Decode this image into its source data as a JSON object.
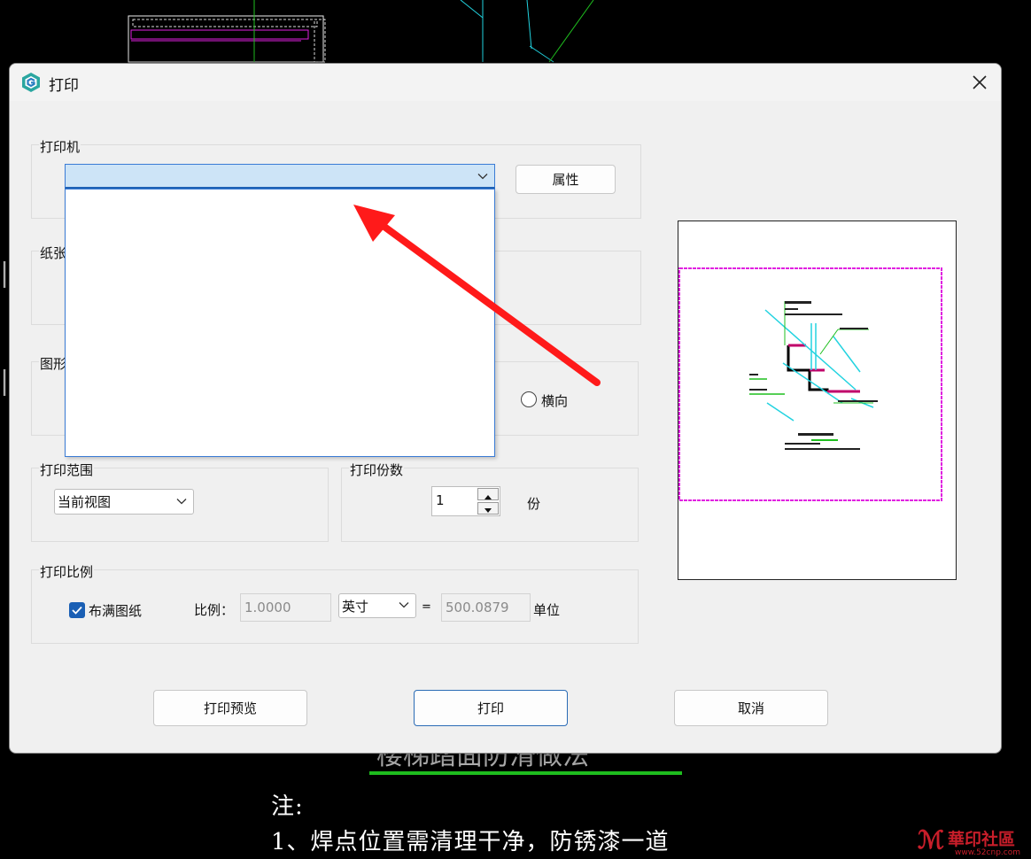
{
  "dialog": {
    "title": "打印",
    "close_glyph": "✕",
    "icon": "app-logo-icon"
  },
  "printer": {
    "group_label": "打印机",
    "selected": "",
    "properties_button": "属性",
    "dropdown_open": true
  },
  "paper": {
    "group_label": "纸张"
  },
  "orientation": {
    "group_label": "图形",
    "landscape_label": "横向",
    "landscape_checked": false
  },
  "range": {
    "group_label": "打印范围",
    "selected": "当前视图"
  },
  "copies": {
    "group_label": "打印份数",
    "value": "1",
    "unit": "份"
  },
  "scale": {
    "group_label": "打印比例",
    "fit_label": "布满图纸",
    "fit_checked": true,
    "ratio_label": "比例：",
    "ratio_value": "1.0000",
    "unit_selected": "英寸",
    "equals": "=",
    "units_value": "500.0879",
    "units_label": "单位"
  },
  "buttons": {
    "preview": "打印预览",
    "print": "打印",
    "cancel": "取消"
  },
  "background": {
    "note_title": "注:",
    "note_line1": "1、焊点位置需清理干净，防锈漆一道",
    "obscured_heading": "楼梯踏面防滑做法",
    "watermark_main": "華印社區",
    "watermark_sub": "www.52cnp.com"
  },
  "colors": {
    "accent": "#1a5fb4",
    "arrow": "#ff1a1a",
    "preview_frame": "#e020e0",
    "cad_green": "#1fbf1f",
    "cad_cyan": "#22d3e0"
  }
}
